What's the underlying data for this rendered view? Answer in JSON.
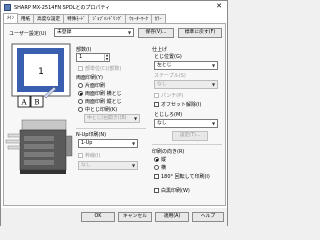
{
  "window": {
    "title": "SHARP MX-2514FN SPDLとのプロパティ",
    "close_glyph": "✕"
  },
  "tabs": [
    {
      "label": "ﾒｲﾝ",
      "active": true
    },
    {
      "label": "用紙",
      "active": false
    },
    {
      "label": "高度な設定",
      "active": false
    },
    {
      "label": "特殊ﾓｰﾄﾞ",
      "active": false
    },
    {
      "label": "ｼﾞｮﾌﾞﾊﾝﾄﾞﾘﾝｸﾞ",
      "active": false
    },
    {
      "label": "ｳｫｰﾀｰﾏｰｸ",
      "active": false
    },
    {
      "label": "ｶﾗｰ",
      "active": false
    }
  ],
  "user_settings": {
    "label": "ユーザー設定(U)",
    "value": "未登録",
    "save_button": "保存(V)...",
    "default_button": "標準に戻す(F)"
  },
  "preview": {
    "page_number": "1",
    "label_a": "A",
    "label_b": "B"
  },
  "copies": {
    "label": "部数(I)",
    "value": "1",
    "checkbox_label": "部単位(C)(部数)"
  },
  "duplex": {
    "label": "両面印刷(Y)",
    "options": [
      {
        "label": "片面印刷",
        "selected": false
      },
      {
        "label": "両面印刷 横とじ",
        "selected": true
      },
      {
        "label": "両面印刷 縦とじ",
        "selected": false
      },
      {
        "label": "中とじ印刷(K)",
        "selected": false
      }
    ],
    "sub_combo": "中とじ(右開き)(B)"
  },
  "nup": {
    "label": "N-Up印刷(N)",
    "value": "1-Up",
    "border_label": "枠線(I)",
    "order_value": "なし"
  },
  "finishing": {
    "title": "仕上げ",
    "binding_label": "とじ位置(G)",
    "binding_value": "左とじ",
    "staple_label": "ステープル(S)",
    "staple_value": "なし",
    "punch_label": "パンチ(P)",
    "offset_label": "オフセット解除(I)",
    "fold_label": "とじしろ(M)",
    "fold_value": "なし",
    "fold_button": "設定(T)..."
  },
  "orientation": {
    "label": "印刷の向き(R)",
    "options": [
      {
        "label": "縦",
        "selected": true
      },
      {
        "label": "横",
        "selected": false
      }
    ],
    "rotate_label": "180° 回転して印刷(I)"
  },
  "mono_label": "白黒印刷(W)",
  "buttons": {
    "ok": "OK",
    "cancel": "キャンセル",
    "apply": "適用(A)",
    "help": "ヘルプ"
  },
  "colors": {
    "screen_accent": "#3a5fb0",
    "machine_body": "#5a5a5a"
  }
}
